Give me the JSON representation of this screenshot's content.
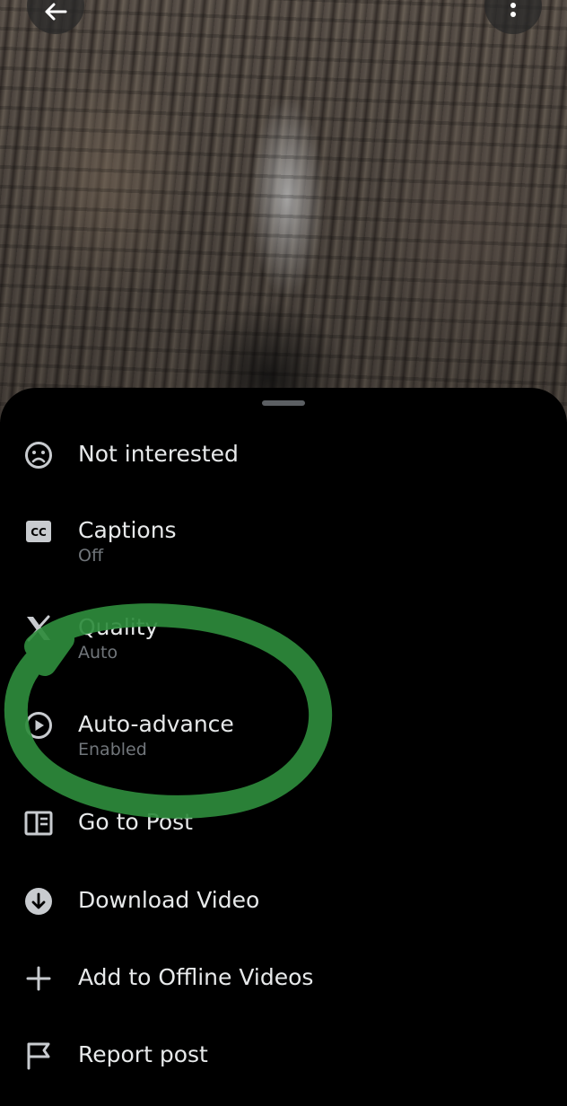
{
  "video": {
    "back_icon": "arrow-left-icon",
    "more_icon": "more-vertical-icon"
  },
  "menu": {
    "items": [
      {
        "label": "Not interested",
        "sub": "",
        "icon": "sad-face-icon"
      },
      {
        "label": "Captions",
        "sub": "Off",
        "icon": "cc-icon"
      },
      {
        "label": "Quality",
        "sub": "Auto",
        "icon": "x-logo-icon"
      },
      {
        "label": "Auto-advance",
        "sub": "Enabled",
        "icon": "play-circle-icon"
      },
      {
        "label": "Go to Post",
        "sub": "",
        "icon": "post-icon"
      },
      {
        "label": "Download Video",
        "sub": "",
        "icon": "download-icon"
      },
      {
        "label": "Add to Offline Videos",
        "sub": "",
        "icon": "plus-icon"
      },
      {
        "label": "Report post",
        "sub": "",
        "icon": "flag-icon"
      }
    ]
  },
  "colors": {
    "text": "#e7e9ea",
    "subtext": "#71767b",
    "icon": "#c8cbcf",
    "highlight": "#2e8b3c"
  }
}
